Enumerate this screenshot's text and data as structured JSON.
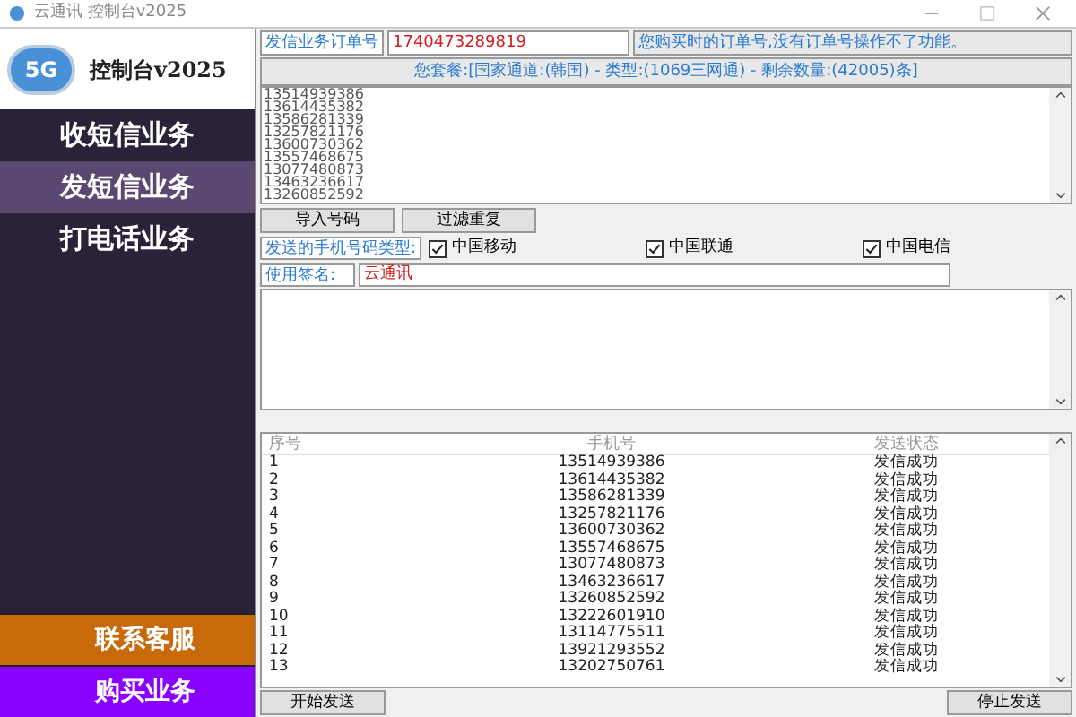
{
  "window": {
    "title": "云通讯 控制台v2025"
  },
  "logo": {
    "badge": "5G",
    "title": "控制台v2025"
  },
  "sidebar": {
    "items": [
      {
        "label": "收短信业务",
        "selected": false
      },
      {
        "label": "发短信业务",
        "selected": true
      },
      {
        "label": "打电话业务",
        "selected": false
      }
    ],
    "footer_buttons": [
      {
        "label": "联系客服",
        "color": "#c8690a"
      },
      {
        "label": "购买业务",
        "color": "#8a00ff"
      }
    ]
  },
  "order": {
    "label": "发信业务订单号",
    "value": "1740473289819",
    "hint": "您购买时的订单号,没有订单号操作不了功能。"
  },
  "package": "您套餐:[国家通道:(韩国) - 类型:(1069三网通) - 剩余数量:(42005)条]",
  "numbers": [
    "13514939386",
    "13614435382",
    "13586281339",
    "13257821176",
    "13600730362",
    "13557468675",
    "13077480873",
    "13463236617",
    "13260852592"
  ],
  "number_buttons": [
    "导入号码",
    "过滤重复"
  ],
  "carriers": {
    "label": "发送的手机号码类型:",
    "items": [
      {
        "label": "中国移动",
        "checked": true
      },
      {
        "label": "中国联通",
        "checked": true
      },
      {
        "label": "中国电信",
        "checked": true
      }
    ]
  },
  "signature": {
    "label": "使用签名:",
    "value": "云通讯"
  },
  "table": {
    "columns": [
      "序号",
      "手机号",
      "发送状态"
    ],
    "rows": [
      [
        "1",
        "13514939386",
        "发信成功"
      ],
      [
        "2",
        "13614435382",
        "发信成功"
      ],
      [
        "3",
        "13586281339",
        "发信成功"
      ],
      [
        "4",
        "13257821176",
        "发信成功"
      ],
      [
        "5",
        "13600730362",
        "发信成功"
      ],
      [
        "6",
        "13557468675",
        "发信成功"
      ],
      [
        "7",
        "13077480873",
        "发信成功"
      ],
      [
        "8",
        "13463236617",
        "发信成功"
      ],
      [
        "9",
        "13260852592",
        "发信成功"
      ],
      [
        "10",
        "13222601910",
        "发信成功"
      ],
      [
        "11",
        "13114775511",
        "发信成功"
      ],
      [
        "12",
        "13921293552",
        "发信成功"
      ],
      [
        "13",
        "13202750761",
        "发信成功"
      ]
    ]
  },
  "actions": [
    "开始发送",
    "停止发送"
  ]
}
